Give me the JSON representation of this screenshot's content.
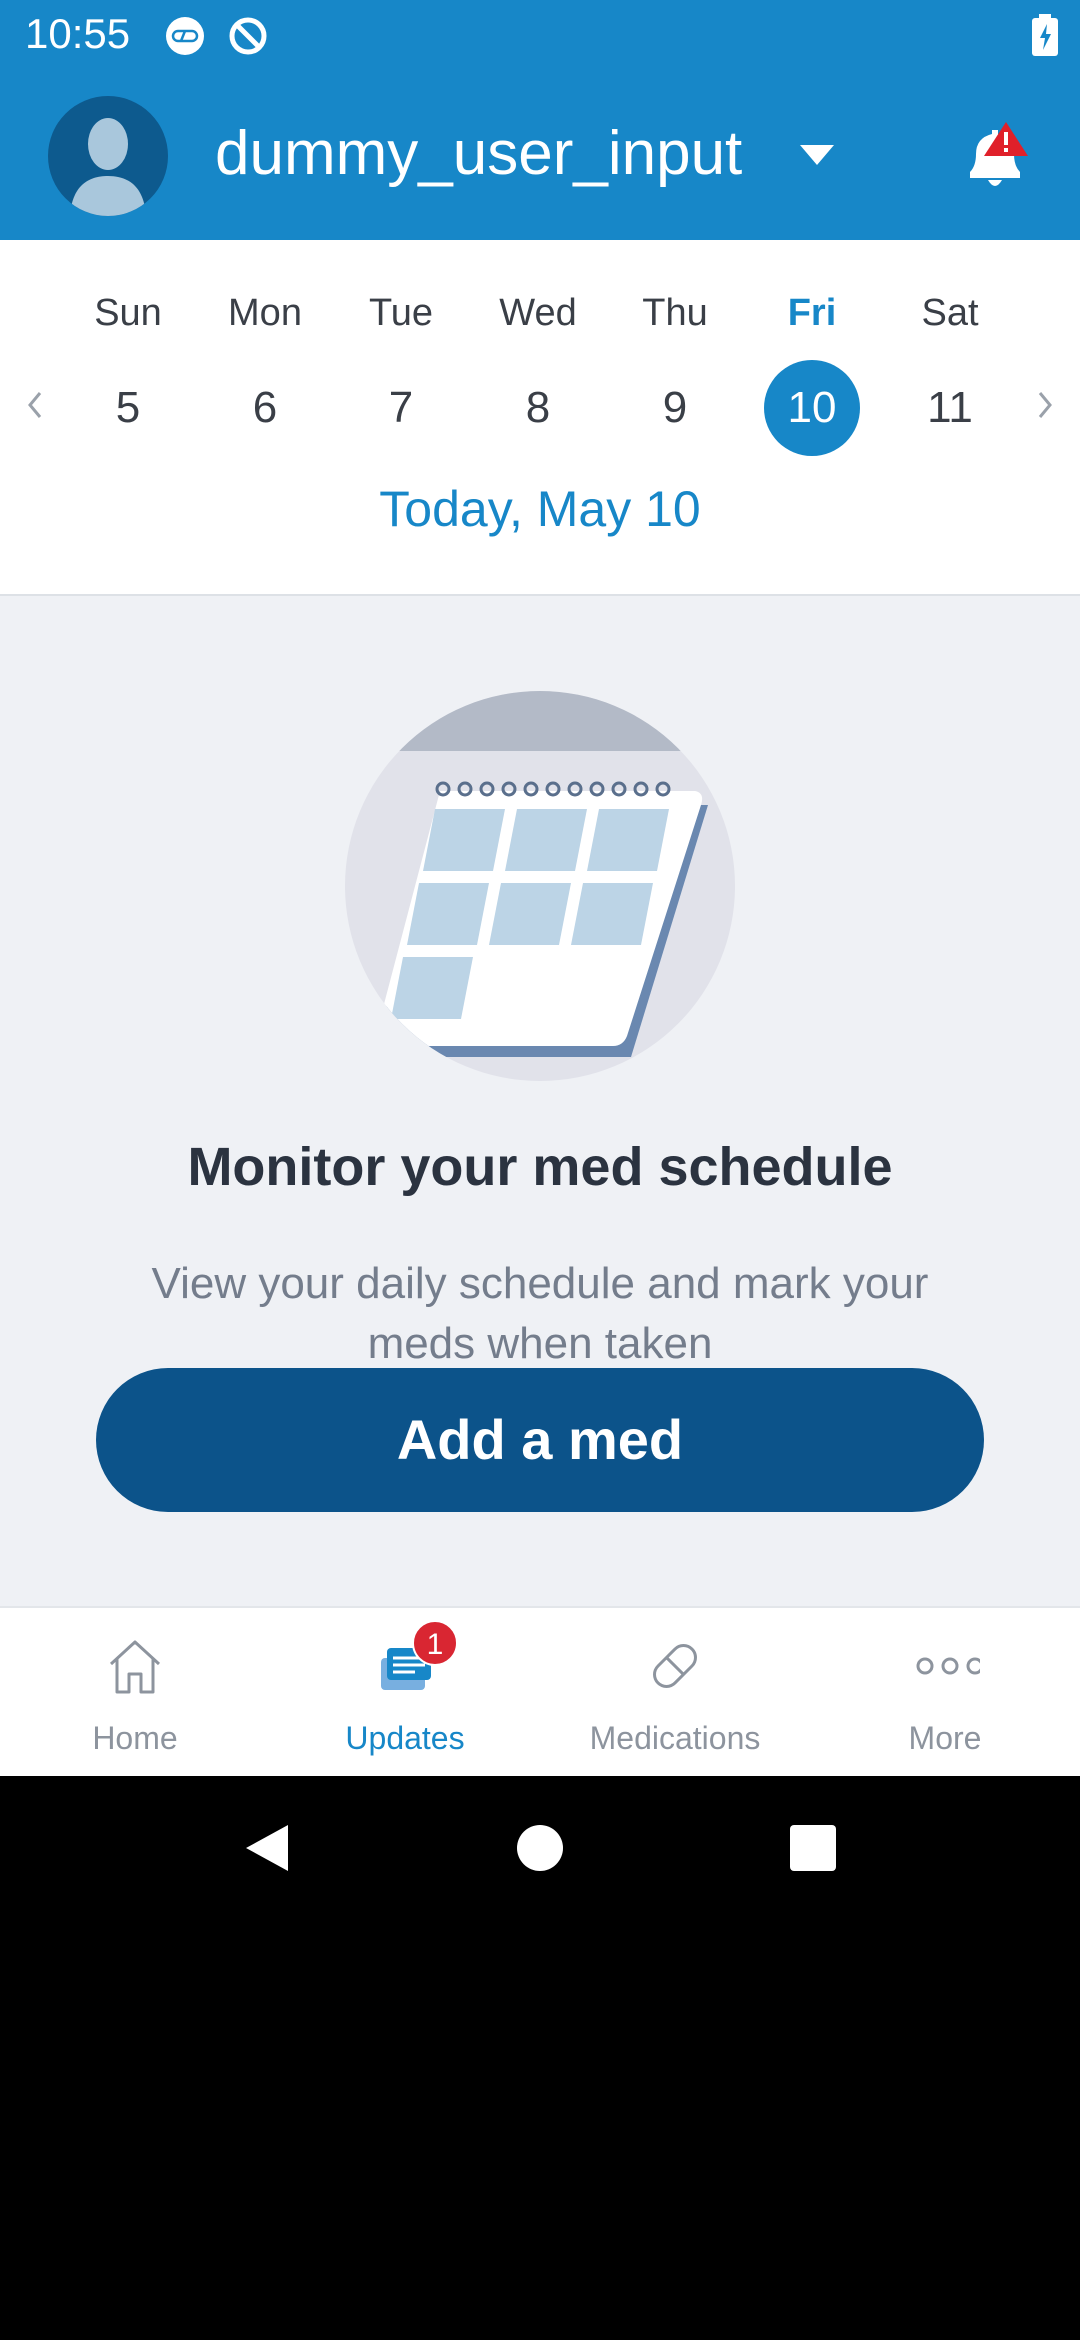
{
  "status_bar": {
    "time": "10:55"
  },
  "header": {
    "username": "dummy_user_input"
  },
  "calendar": {
    "days": [
      {
        "name": "Sun",
        "date": "5"
      },
      {
        "name": "Mon",
        "date": "6"
      },
      {
        "name": "Tue",
        "date": "7"
      },
      {
        "name": "Wed",
        "date": "8"
      },
      {
        "name": "Thu",
        "date": "9"
      },
      {
        "name": "Fri",
        "date": "10"
      },
      {
        "name": "Sat",
        "date": "11"
      }
    ],
    "selected_index": 5,
    "today_label": "Today, May 10"
  },
  "main": {
    "headline": "Monitor your med schedule",
    "description": "View your daily schedule and mark your meds when taken",
    "add_button": "Add a med"
  },
  "bottom_nav": {
    "items": [
      {
        "label": "Home",
        "icon": "home-icon"
      },
      {
        "label": "Updates",
        "icon": "updates-icon",
        "badge": "1"
      },
      {
        "label": "Medications",
        "icon": "pill-icon"
      },
      {
        "label": "More",
        "icon": "more-icon"
      }
    ],
    "active_index": 1
  },
  "colors": {
    "header_blue": "#1787c8",
    "button_dark_blue": "#0c538a",
    "badge_red": "#d92632",
    "background": "#eff1f5"
  }
}
